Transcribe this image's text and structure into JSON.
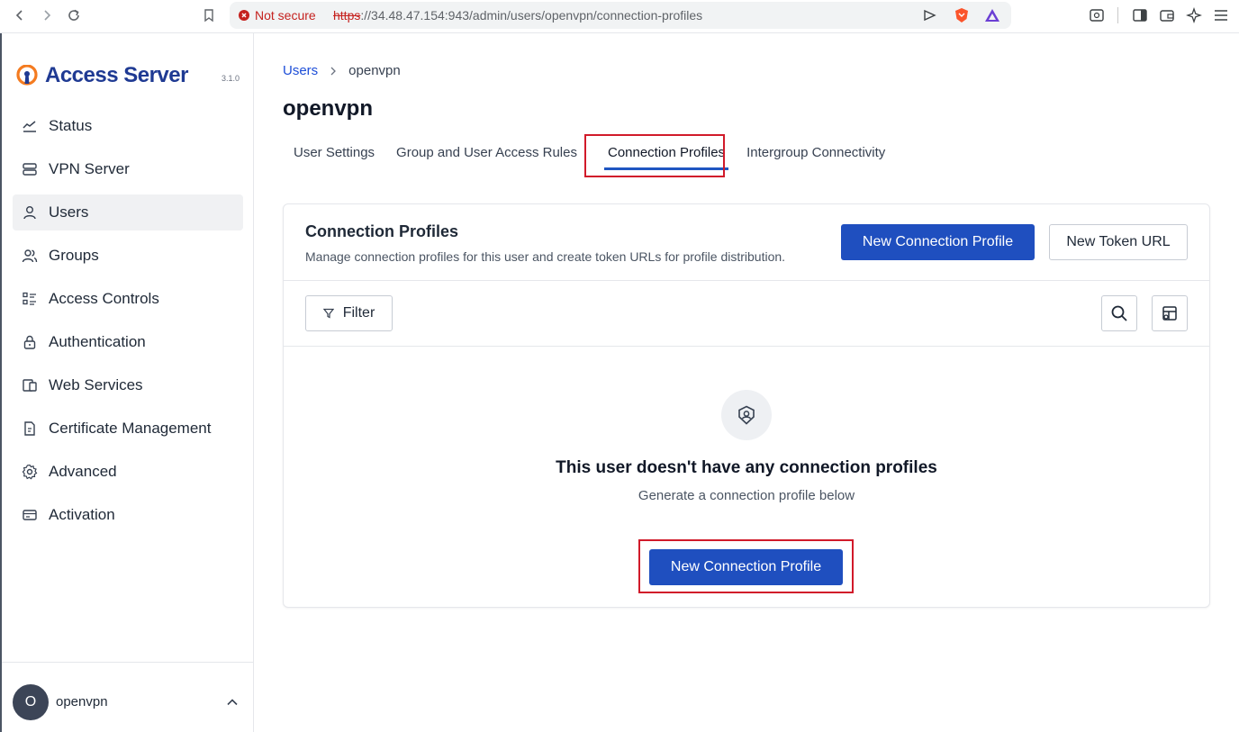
{
  "browser": {
    "security_label": "Not secure",
    "url_scheme": "https",
    "url_rest": "://34.48.47.154:943/admin/users/openvpn/connection-profiles"
  },
  "brand": {
    "name": "Access Server",
    "version": "3.1.0",
    "accent_color": "#f47b20",
    "primary_color": "#1f3a93"
  },
  "sidebar": {
    "items": [
      {
        "label": "Status",
        "icon": "chart-line-icon",
        "active": false
      },
      {
        "label": "VPN Server",
        "icon": "server-icon",
        "active": false
      },
      {
        "label": "Users",
        "icon": "user-icon",
        "active": true
      },
      {
        "label": "Groups",
        "icon": "users-icon",
        "active": false
      },
      {
        "label": "Access Controls",
        "icon": "list-check-icon",
        "active": false
      },
      {
        "label": "Authentication",
        "icon": "lock-icon",
        "active": false
      },
      {
        "label": "Web Services",
        "icon": "devices-icon",
        "active": false
      },
      {
        "label": "Certificate Management",
        "icon": "certificate-file-icon",
        "active": false
      },
      {
        "label": "Advanced",
        "icon": "gear-icon",
        "active": false
      },
      {
        "label": "Activation",
        "icon": "card-icon",
        "active": false
      }
    ],
    "footer": {
      "avatar_initial": "O",
      "username": "openvpn"
    }
  },
  "main": {
    "breadcrumb": {
      "parent": "Users",
      "current": "openvpn"
    },
    "title": "openvpn",
    "tabs": [
      {
        "label": "User Settings",
        "active": false
      },
      {
        "label": "Group and User Access Rules",
        "active": false
      },
      {
        "label": "Connection Profiles",
        "active": true
      },
      {
        "label": "Intergroup Connectivity",
        "active": false
      }
    ],
    "card": {
      "title": "Connection Profiles",
      "description": "Manage connection profiles for this user and create token URLs for profile distribution.",
      "new_profile_label": "New Connection Profile",
      "new_token_label": "New Token URL",
      "filter_label": "Filter",
      "empty_title": "This user doesn't have any connection profiles",
      "empty_subtitle": "Generate a connection profile below",
      "empty_button_label": "New Connection Profile"
    }
  },
  "colors": {
    "primary_button": "#1f4fbf",
    "highlight": "#d11a2a"
  }
}
